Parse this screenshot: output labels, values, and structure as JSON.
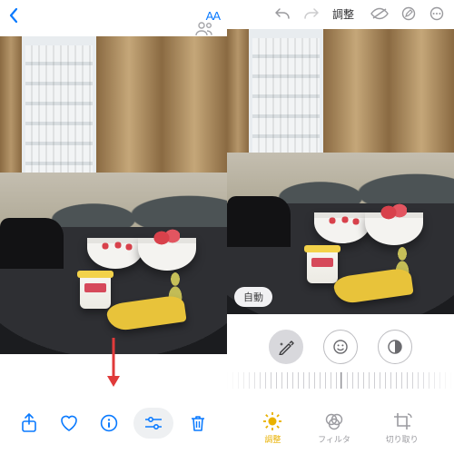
{
  "colors": {
    "accent_blue": "#0a7aff",
    "accent_yellow": "#e9b100",
    "gray": "#8e8e93"
  },
  "left": {
    "toolbar": {
      "share": "share-icon",
      "favorite": "heart-icon",
      "info": "info-icon",
      "edit": "sliders-icon",
      "trash": "trash-icon"
    }
  },
  "right": {
    "header": {
      "undo": "undo-icon",
      "redo": "redo-icon",
      "adjust_label": "調整",
      "hide": "eye-off-icon",
      "markup": "markup-icon",
      "more": "more-icon"
    },
    "auto_label": "自動",
    "dials": {
      "auto": "wand-icon",
      "exposure": "exposure-icon",
      "brilliance": "contrast-icon"
    },
    "tabs": {
      "adjust": {
        "label": "調整"
      },
      "filter": {
        "label": "フィルタ"
      },
      "crop": {
        "label": "切り取り"
      }
    }
  }
}
